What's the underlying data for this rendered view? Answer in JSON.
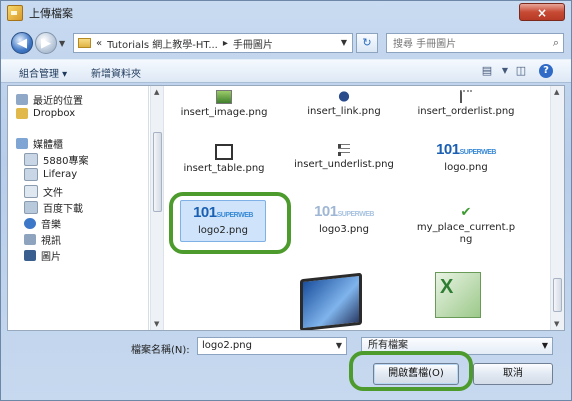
{
  "window": {
    "title": "上傳檔案",
    "close_label": "×"
  },
  "address": {
    "back_glyph": "◀",
    "forward_glyph": "▶",
    "breadcrumb": [
      "«",
      "Tutorials 網上教學-HT...",
      "▸",
      "手冊圖片"
    ],
    "refresh_glyph": "↻",
    "search_placeholder": "搜尋 手冊圖片"
  },
  "toolbar": {
    "organize": "組合管理 ▾",
    "new_folder": "新增資料夾",
    "help": "?"
  },
  "nav": {
    "items": [
      {
        "label": "最近的位置",
        "icon": "recent-places-icon"
      },
      {
        "label": "Dropbox",
        "icon": "dropbox-icon"
      },
      {
        "label": "媒體櫃",
        "icon": "libraries-icon"
      },
      {
        "label": "5880專案",
        "icon": "library-icon"
      },
      {
        "label": "Liferay",
        "icon": "library-icon"
      },
      {
        "label": "文件",
        "icon": "documents-icon"
      },
      {
        "label": "百度下載",
        "icon": "downloads-icon"
      },
      {
        "label": "音樂",
        "icon": "music-icon"
      },
      {
        "label": "視訊",
        "icon": "videos-icon"
      },
      {
        "label": "圖片",
        "icon": "pictures-icon"
      }
    ]
  },
  "files": [
    {
      "name": "insert_image.png",
      "icon": "image-file-icon"
    },
    {
      "name": "insert_link.png",
      "icon": "link-file-icon"
    },
    {
      "name": "insert_orderlist.png",
      "icon": "orderlist-file-icon"
    },
    {
      "name": "insert_table.png",
      "icon": "table-file-icon"
    },
    {
      "name": "insert_underlist.png",
      "icon": "underlist-file-icon"
    },
    {
      "name": "logo.png",
      "icon": "logo-thumbnail",
      "brand": "101",
      "brand_sub": "SUPERWEB"
    },
    {
      "name": "logo2.png",
      "icon": "logo-thumbnail",
      "brand": "101",
      "brand_sub": "SUPERWEB",
      "selected": true
    },
    {
      "name": "logo3.png",
      "icon": "logo-thumbnail",
      "brand": "101",
      "brand_sub": "SUPERWEB"
    },
    {
      "name": "my_place_current.png",
      "icon": "checkmark-file-icon"
    }
  ],
  "footer": {
    "filename_label": "檔案名稱(N):",
    "filename_value": "logo2.png",
    "filetype_value": "所有檔案",
    "open_button": "開啟舊檔(O)",
    "cancel_button": "取消"
  },
  "colors": {
    "highlight_ring": "#4c9b2c",
    "brand_blue": "#1b5fb2",
    "selection": "#cfe4fb"
  }
}
